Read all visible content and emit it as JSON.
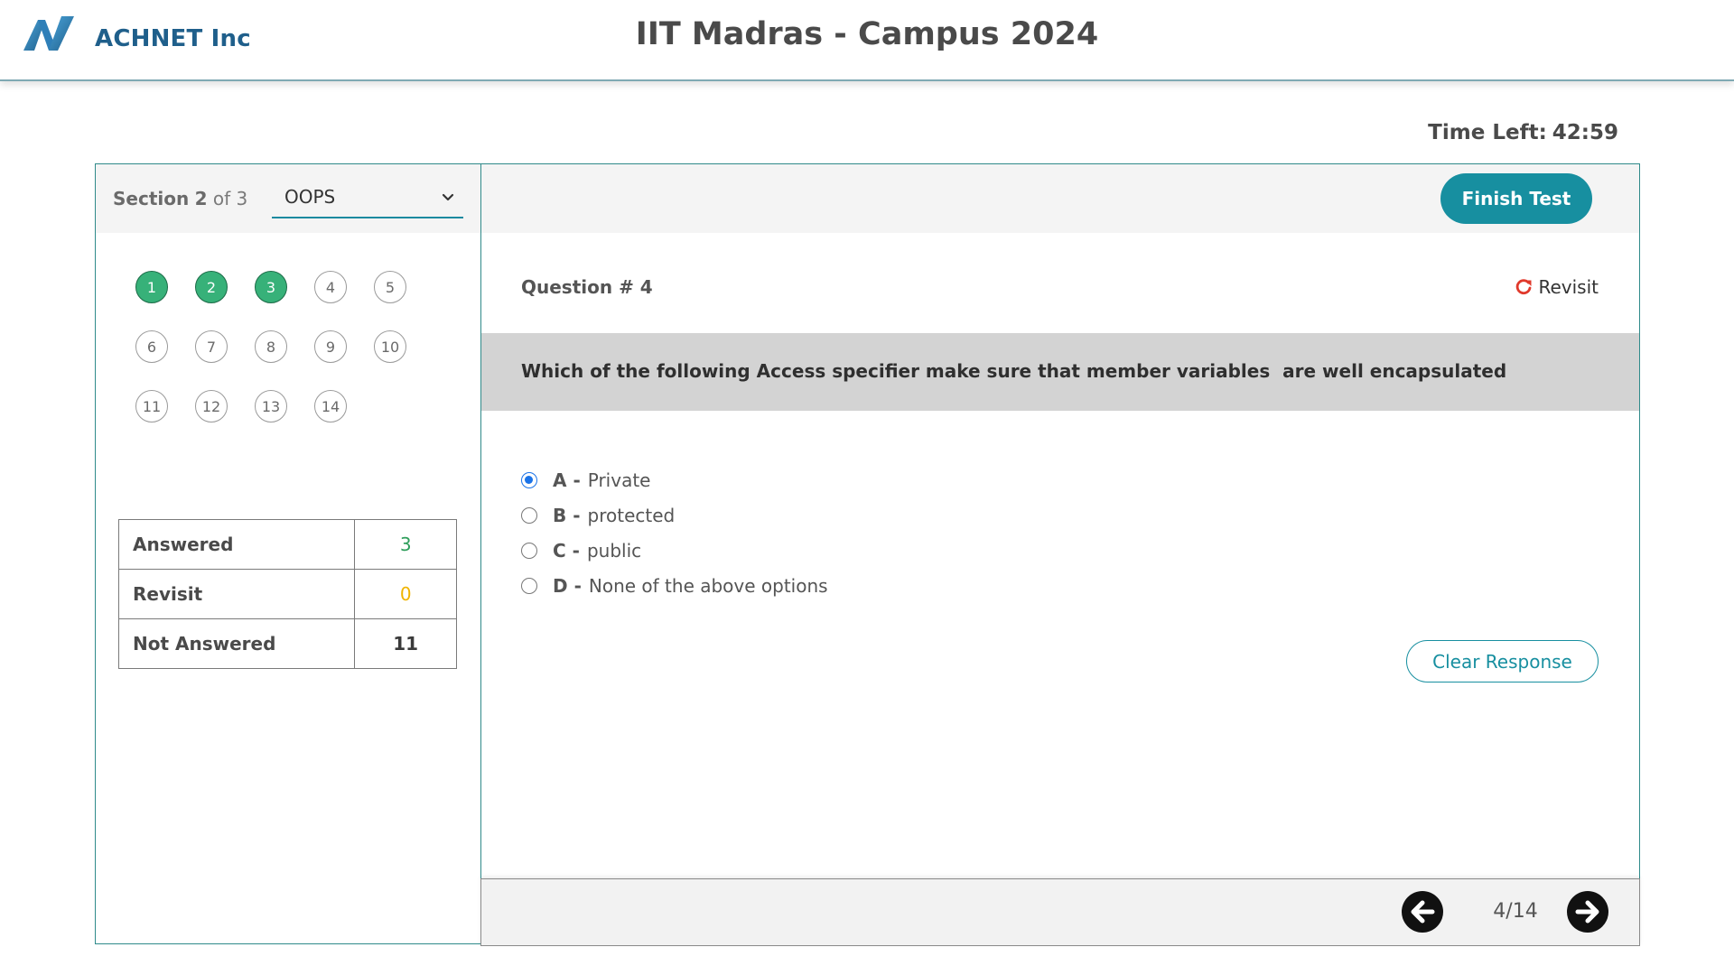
{
  "header": {
    "logo_icon": "achnet-logo-icon",
    "brand": "ACHNET Inc",
    "title": "IIT Madras - Campus 2024"
  },
  "timer": {
    "label": "Time Left:",
    "value": "42:59"
  },
  "section": {
    "label_prefix": "Section",
    "current": "2",
    "of_text": "of",
    "total": "3",
    "selected": "OOPS",
    "dropdown_icon": "chevron-down-icon"
  },
  "question_palette": [
    {
      "num": "1",
      "status": "answered"
    },
    {
      "num": "2",
      "status": "answered"
    },
    {
      "num": "3",
      "status": "answered"
    },
    {
      "num": "4",
      "status": "not-answered"
    },
    {
      "num": "5",
      "status": "not-answered"
    },
    {
      "num": "6",
      "status": "not-answered"
    },
    {
      "num": "7",
      "status": "not-answered"
    },
    {
      "num": "8",
      "status": "not-answered"
    },
    {
      "num": "9",
      "status": "not-answered"
    },
    {
      "num": "10",
      "status": "not-answered"
    },
    {
      "num": "11",
      "status": "not-answered"
    },
    {
      "num": "12",
      "status": "not-answered"
    },
    {
      "num": "13",
      "status": "not-answered"
    },
    {
      "num": "14",
      "status": "not-answered"
    }
  ],
  "summary": [
    {
      "label": "Answered",
      "value": "3",
      "color": "#2e9e5b"
    },
    {
      "label": "Revisit",
      "value": "0",
      "color": "#f0b400"
    },
    {
      "label": "Not Answered",
      "value": "11",
      "color": "#3a3a3a"
    }
  ],
  "actions": {
    "finish": "Finish Test",
    "revisit": "Revisit",
    "revisit_icon": "refresh-icon",
    "clear": "Clear Response"
  },
  "question": {
    "number_label": "Question # 4",
    "text": "Which of the following Access specifier make sure that member variables  are well encapsulated",
    "options": [
      {
        "key": "A -",
        "text": "Private",
        "selected": true
      },
      {
        "key": "B -",
        "text": "protected",
        "selected": false
      },
      {
        "key": "C -",
        "text": "public",
        "selected": false
      },
      {
        "key": "D -",
        "text": "None of the above options",
        "selected": false
      }
    ]
  },
  "navigation": {
    "prev_icon": "arrow-left-circle-icon",
    "next_icon": "arrow-right-circle-icon",
    "pager": "4/14"
  },
  "colors": {
    "accent": "#178fa0",
    "answered": "#37b179",
    "brand": "#1f5f8b",
    "selected_radio": "#1a73e8",
    "revisit_icon": "#e0392b"
  }
}
